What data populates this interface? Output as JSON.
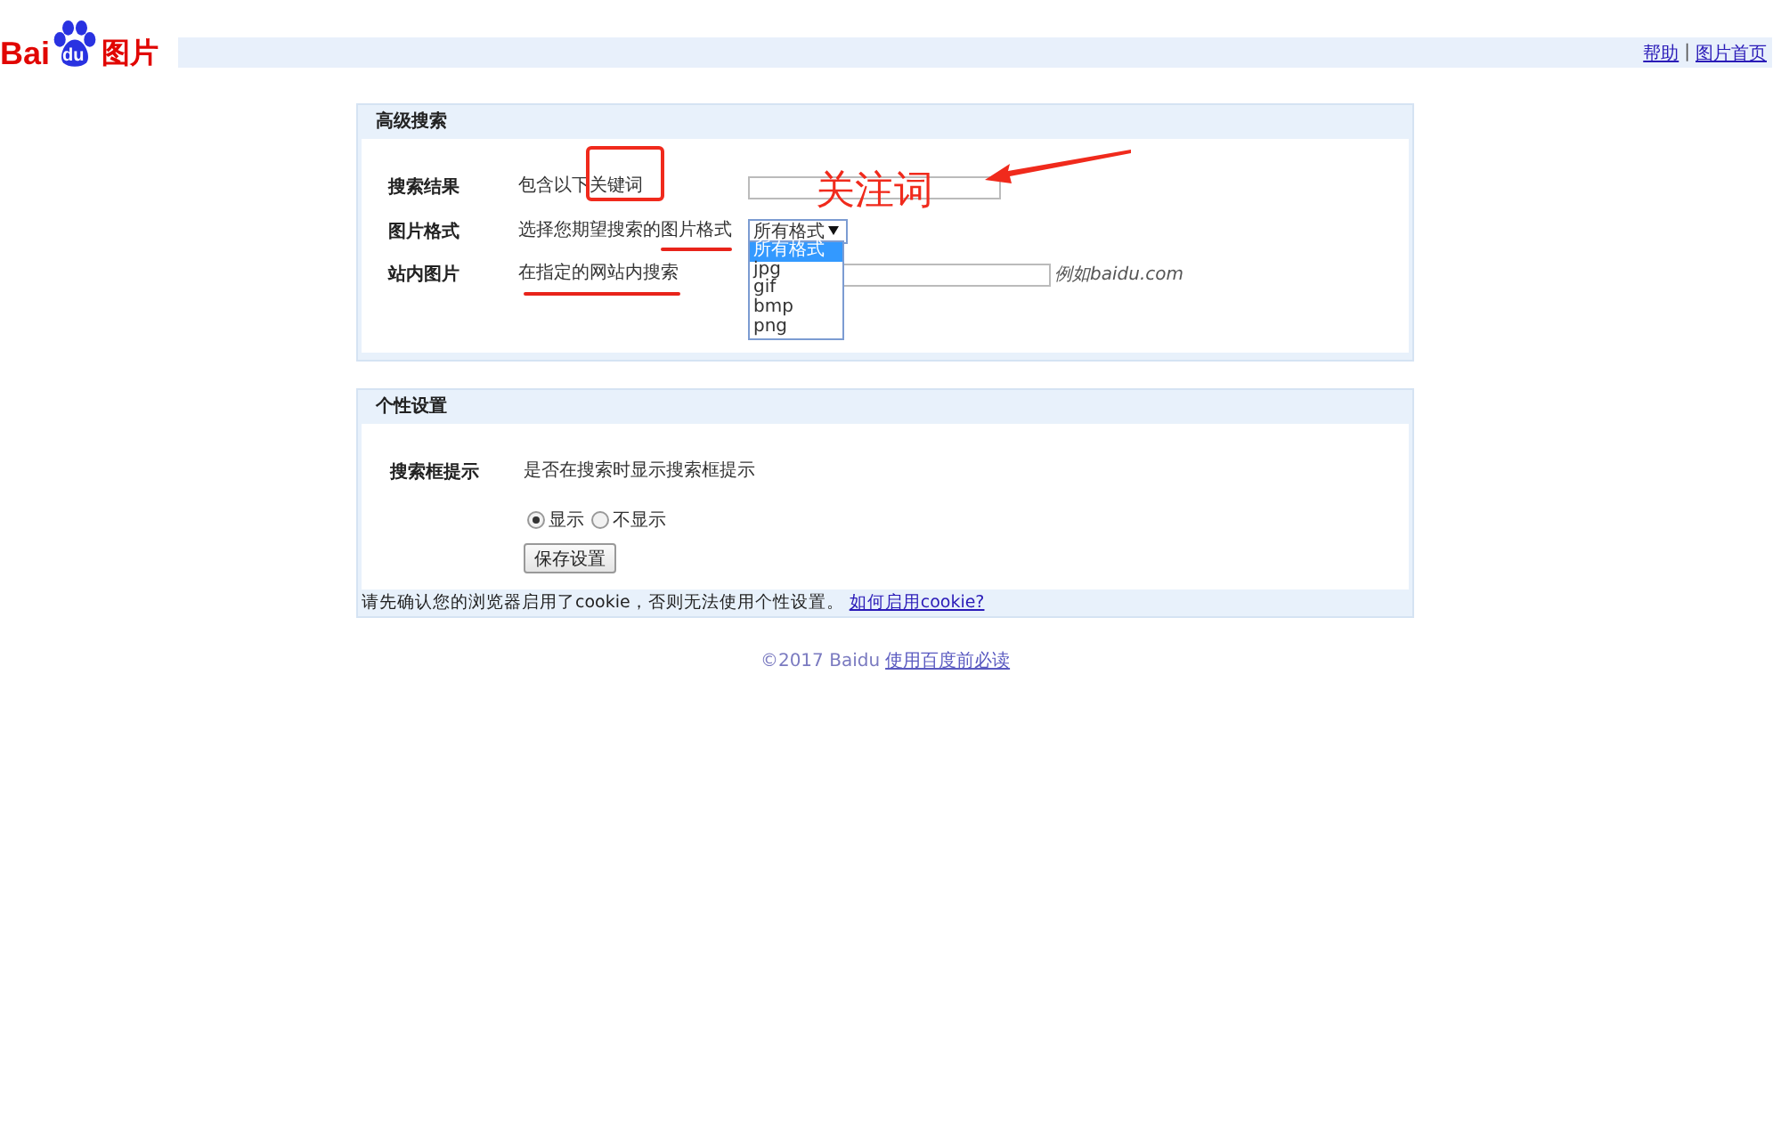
{
  "logo": {
    "left": "Bai",
    "paw": "du",
    "right": "图片"
  },
  "top_links": [
    {
      "label": "帮助"
    },
    {
      "label": "图片首页"
    }
  ],
  "top_separator": "|",
  "advanced_search": {
    "title": "高级搜索",
    "rows": [
      {
        "kind": "text",
        "label": "搜索结果",
        "description": "包含以下关键词"
      },
      {
        "kind": "select",
        "label": "图片格式",
        "description": "选择您期望搜索的图片格式",
        "value": "所有格式",
        "expanded": true,
        "options": [
          {
            "label": "所有格式",
            "selected": true
          },
          {
            "label": "jpg",
            "selected": false
          },
          {
            "label": "gif",
            "selected": false
          },
          {
            "label": "bmp",
            "selected": false
          },
          {
            "label": "png",
            "selected": false
          }
        ]
      },
      {
        "kind": "site",
        "label": "站内图片",
        "description": "在指定的网站内搜索",
        "hint": "例如baidu.com"
      }
    ]
  },
  "personal_settings": {
    "title": "个性设置",
    "label": "搜索框提示",
    "description": "是否在搜索时显示搜索框提示",
    "radios": [
      {
        "label": "显示",
        "selected": true
      },
      {
        "label": "不显示",
        "selected": false
      }
    ],
    "save_button": "保存设置",
    "cookie_note": "请先确认您的浏览器启用了cookie，否则无法使用个性设置。",
    "cookie_link": "如何启用cookie?"
  },
  "footer": {
    "copyright": "©2017 Baidu",
    "link": "使用百度前必读"
  },
  "annotations": [
    {
      "kind": "box"
    },
    {
      "kind": "underline"
    },
    {
      "kind": "underline"
    },
    {
      "kind": "arrow"
    },
    {
      "kind": "label",
      "text": "关注词"
    }
  ]
}
